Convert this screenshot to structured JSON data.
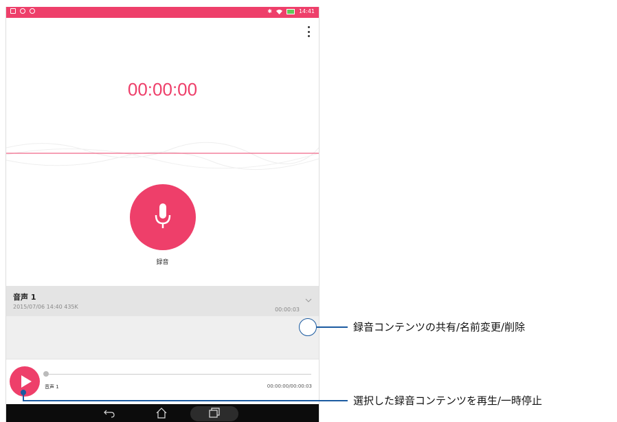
{
  "statusbar": {
    "time": "14:41"
  },
  "recorder": {
    "timer": "00:00:00",
    "record_label": "録音"
  },
  "recording": {
    "title": "音声 1",
    "meta": "2015/07/06 14:40  435K",
    "duration": "00:00:03"
  },
  "player": {
    "title": "音声 1",
    "time": "00:00:00/00:00:03"
  },
  "callouts": {
    "share_rename_delete": "録音コンテンツの共有/名前変更/削除",
    "play_pause": "選択した録音コンテンツを再生/一時停止"
  },
  "colors": {
    "accent": "#ee3f6a",
    "callout": "#1a5aa0"
  },
  "icons": {
    "status_left": [
      "gallery-icon",
      "sync-icon",
      "notification-icon"
    ],
    "status_right": [
      "bluetooth-icon",
      "wifi-icon",
      "battery-icon"
    ],
    "nav": [
      "back-icon",
      "home-icon",
      "recents-icon"
    ]
  }
}
